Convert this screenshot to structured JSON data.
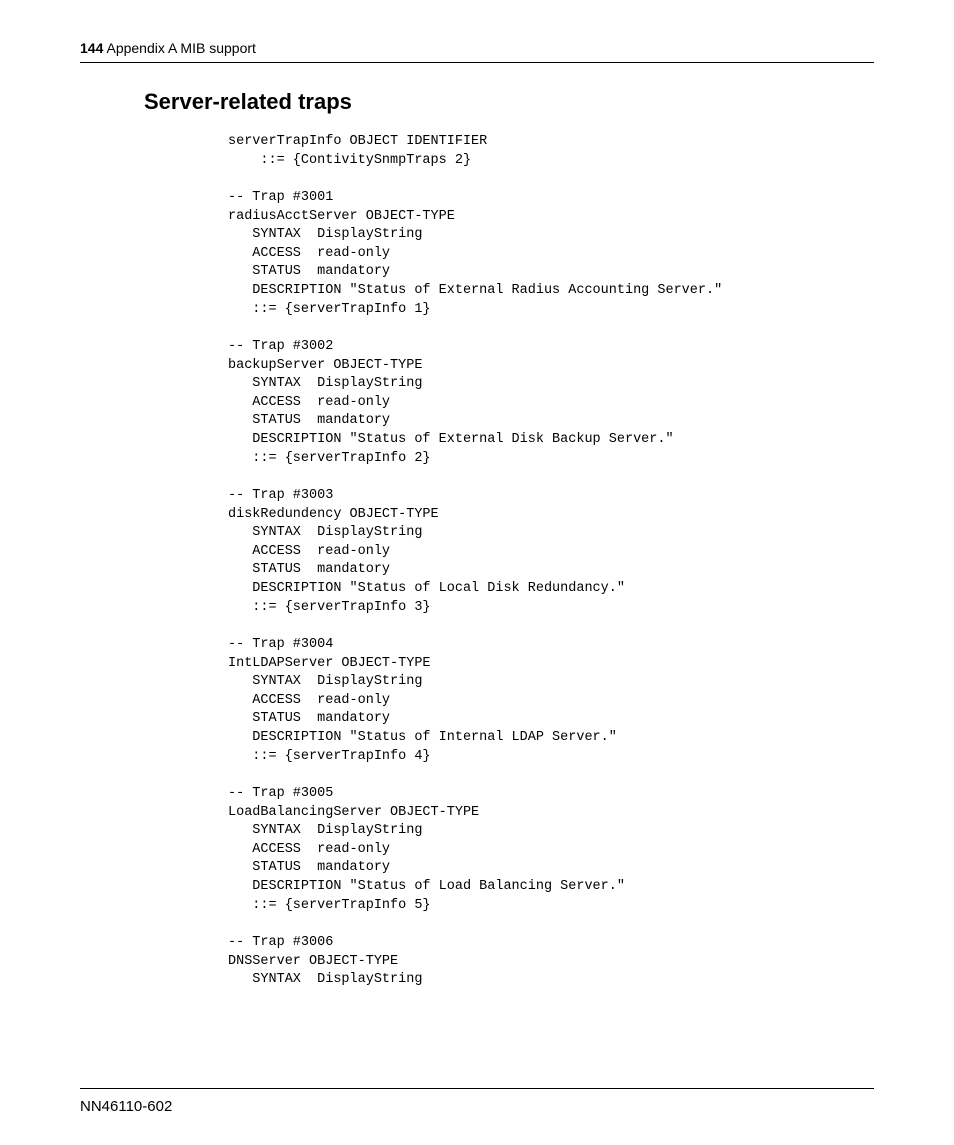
{
  "header": {
    "pagenum": "144",
    "section": "Appendix A  MIB support"
  },
  "title": "Server-related traps",
  "code": "serverTrapInfo OBJECT IDENTIFIER\n    ::= {ContivitySnmpTraps 2}\n\n-- Trap #3001\nradiusAcctServer OBJECT-TYPE\n   SYNTAX  DisplayString\n   ACCESS  read-only\n   STATUS  mandatory\n   DESCRIPTION \"Status of External Radius Accounting Server.\"\n   ::= {serverTrapInfo 1}\n\n-- Trap #3002\nbackupServer OBJECT-TYPE\n   SYNTAX  DisplayString\n   ACCESS  read-only\n   STATUS  mandatory\n   DESCRIPTION \"Status of External Disk Backup Server.\"\n   ::= {serverTrapInfo 2}\n\n-- Trap #3003\ndiskRedundency OBJECT-TYPE\n   SYNTAX  DisplayString\n   ACCESS  read-only\n   STATUS  mandatory\n   DESCRIPTION \"Status of Local Disk Redundancy.\"\n   ::= {serverTrapInfo 3}\n\n-- Trap #3004\nIntLDAPServer OBJECT-TYPE\n   SYNTAX  DisplayString\n   ACCESS  read-only\n   STATUS  mandatory\n   DESCRIPTION \"Status of Internal LDAP Server.\"\n   ::= {serverTrapInfo 4}\n\n-- Trap #3005\nLoadBalancingServer OBJECT-TYPE\n   SYNTAX  DisplayString\n   ACCESS  read-only\n   STATUS  mandatory\n   DESCRIPTION \"Status of Load Balancing Server.\"\n   ::= {serverTrapInfo 5}\n\n-- Trap #3006\nDNSServer OBJECT-TYPE\n   SYNTAX  DisplayString",
  "footer": "NN46110-602"
}
